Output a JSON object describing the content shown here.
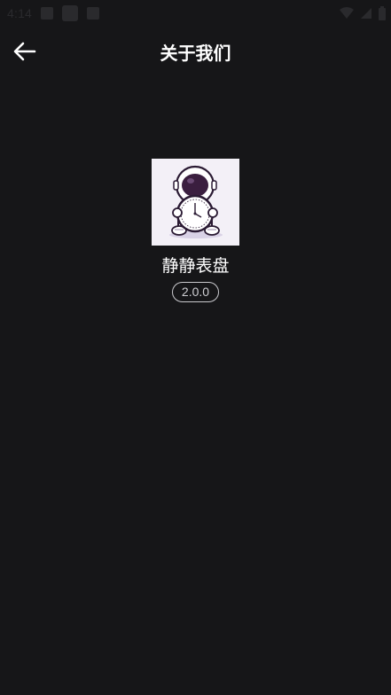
{
  "status_bar": {
    "time": "4:14",
    "icons": [
      "image-icon",
      "app-icon",
      "settings-icon",
      "wifi-icon",
      "signal-icon",
      "battery-icon"
    ]
  },
  "header": {
    "back_icon": "arrow-left-icon",
    "title": "关于我们"
  },
  "about": {
    "logo": "astronaut-clock-logo",
    "app_name": "静静表盘",
    "version": "2.0.0"
  },
  "colors": {
    "background": "#161618",
    "text": "#ffffff",
    "logo_background": "#f2eff6",
    "badge_border": "#c9c9cd"
  }
}
